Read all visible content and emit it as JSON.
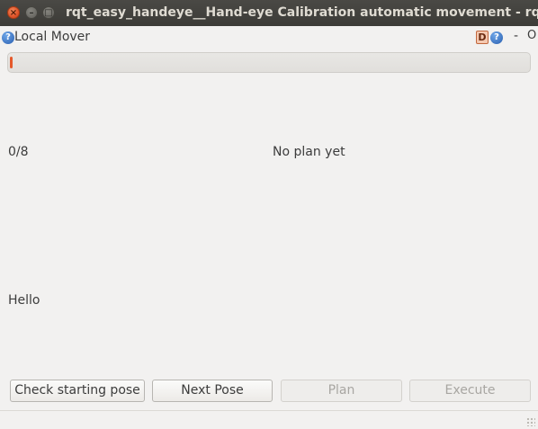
{
  "window": {
    "title": "rqt_easy_handeye__Hand-eye Calibration automatic movement - rqt",
    "close_glyph": "×",
    "minimize_glyph": "–",
    "maximize_glyph": "□"
  },
  "dock": {
    "title": "Local Mover",
    "help_glyph": "?",
    "d_label": "D",
    "minimize_label": "-",
    "close_label": "O"
  },
  "progress": {
    "value_fraction": 0.005,
    "color": "#e5592b"
  },
  "labels": {
    "pose_counter": "0/8",
    "plan_status": "No plan yet",
    "message": "Hello"
  },
  "buttons": {
    "check_starting_pose": "Check starting pose",
    "next_pose": "Next Pose",
    "plan": "Plan",
    "execute": "Execute"
  },
  "icons": {
    "help": "help-icon",
    "debug": "d-icon",
    "resize": "resize-grip-icon"
  }
}
